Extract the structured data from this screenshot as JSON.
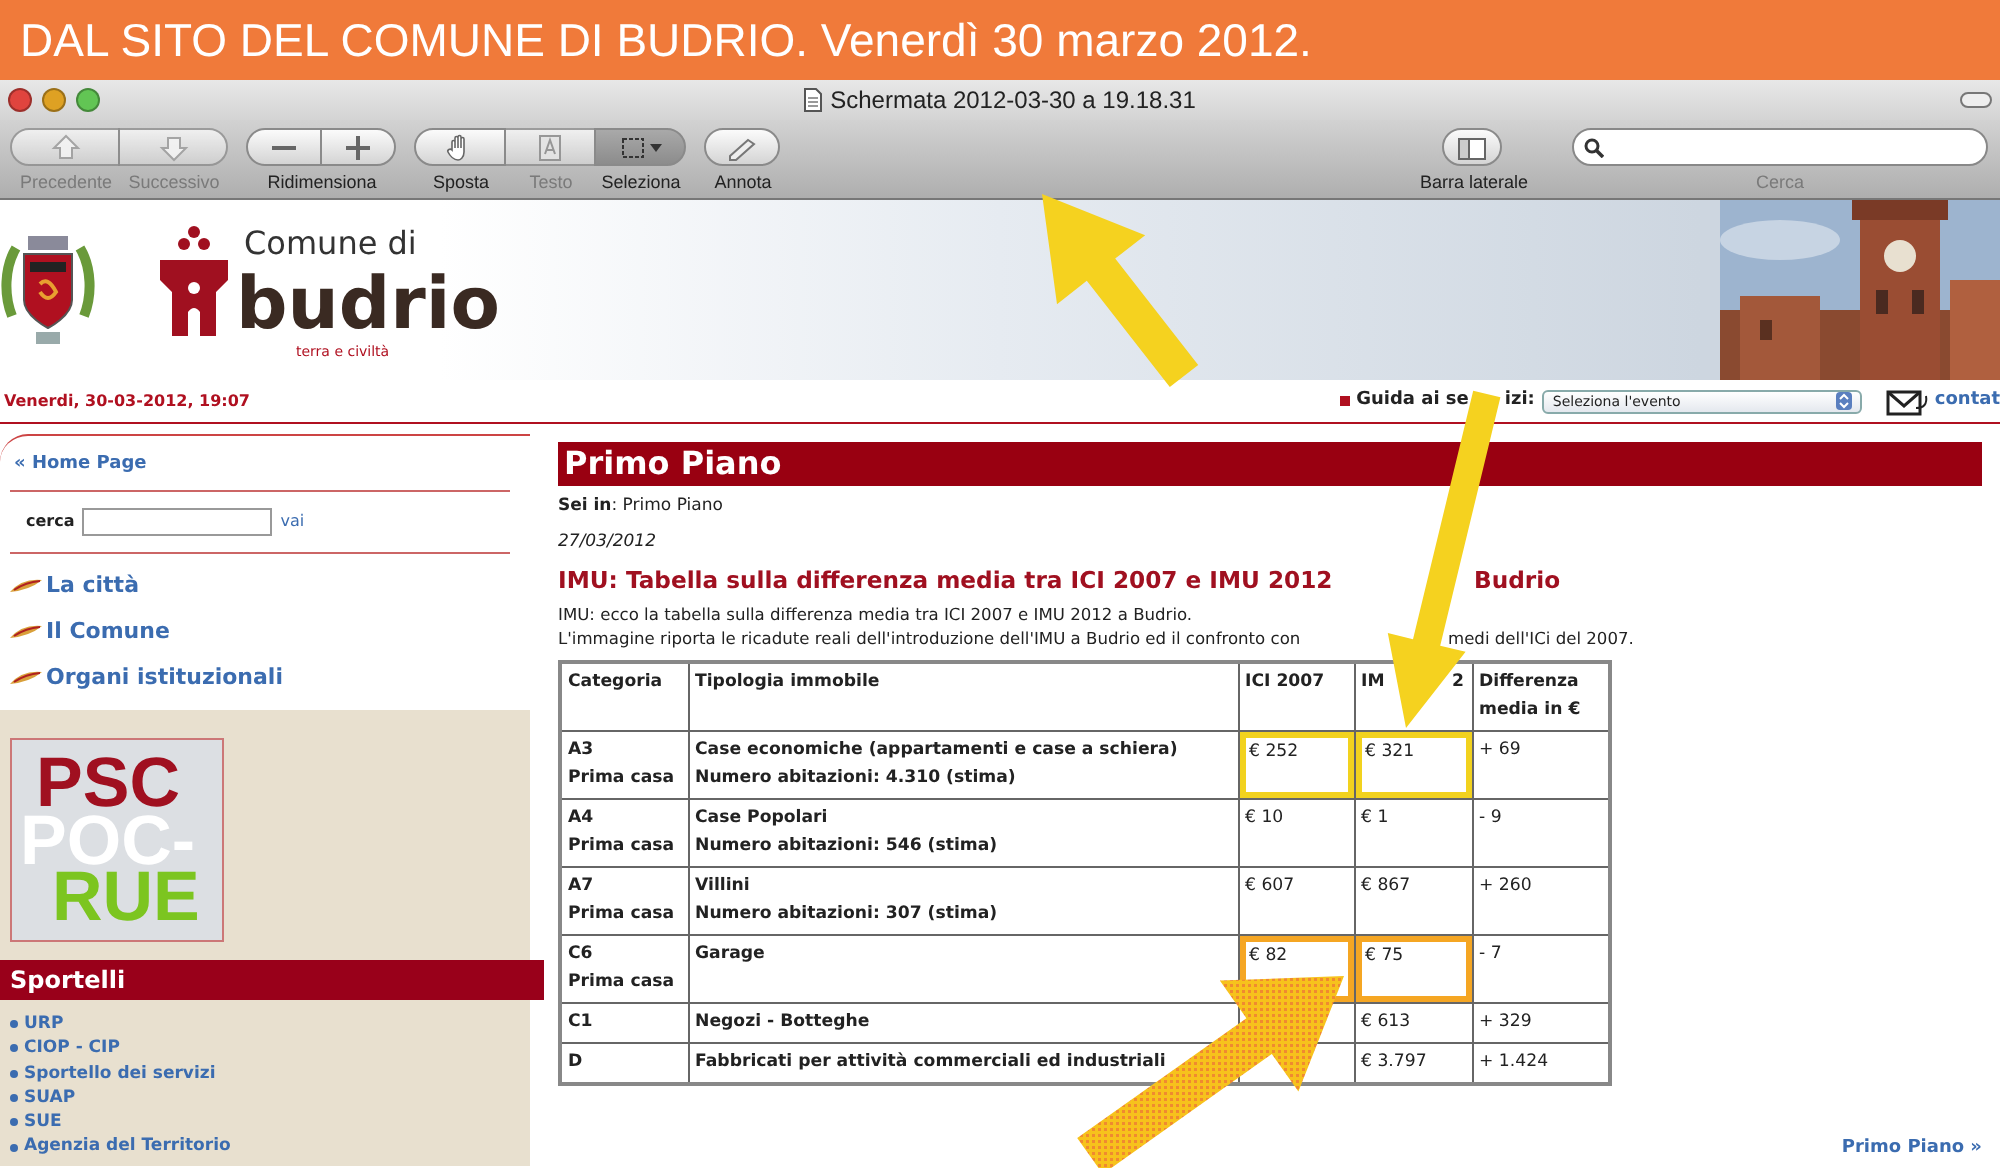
{
  "banner": {
    "text": "DAL SITO DEL COMUNE DI BUDRIO. Venerdì 30 marzo 2012."
  },
  "window": {
    "title": "Schermata 2012-03-30 a 19.18.31"
  },
  "toolbar": {
    "groups": [
      {
        "buttons": [
          {
            "kind": "up",
            "label": "Precedente",
            "disabled": true
          },
          {
            "kind": "down",
            "label": "Successivo",
            "disabled": true
          }
        ]
      },
      {
        "label": "Ridimensiona",
        "buttons": [
          {
            "kind": "minus",
            "disabled": false
          },
          {
            "kind": "plus",
            "disabled": false
          }
        ]
      },
      {
        "buttons": [
          {
            "kind": "hand",
            "label": "Sposta",
            "disabled": false,
            "selected": false
          },
          {
            "kind": "text",
            "label": "Testo",
            "disabled": true,
            "selected": false
          },
          {
            "kind": "select",
            "label": "Seleziona",
            "disabled": false,
            "selected": true
          }
        ]
      },
      {
        "buttons": [
          {
            "kind": "pencil",
            "label": "Annota",
            "disabled": false
          }
        ]
      }
    ],
    "sidebar_button": {
      "label": "Barra laterale"
    },
    "search": {
      "label": "Cerca"
    }
  },
  "site_header": {
    "comune": "Comune di",
    "name": "budrio",
    "motto": "terra e civiltà"
  },
  "site_bar": {
    "date": "Venerdi, 30-03-2012, 19:07",
    "guide_label_parts": [
      "Guida ai se",
      "izi:"
    ],
    "guide_select": "Seleziona l'evento",
    "contact": "contat"
  },
  "sidebar": {
    "home": "« Home Page",
    "search_label": "cerca",
    "search_button": "vai",
    "menu": [
      "La città",
      "Il Comune",
      "Organi istituzionali"
    ],
    "banner_lines": [
      "PSC",
      "POC-",
      "RUE"
    ],
    "desk_title": "Sportelli",
    "desks": [
      "URP",
      "CIOP - CIP",
      "Sportello dei servizi",
      "SUAP",
      "SUE",
      "Agenzia del Territorio"
    ]
  },
  "main": {
    "section_title": "Primo Piano",
    "breadcrumb": "**Sei in**: Primo Piano",
    "date": "27/03/2012",
    "title_parts": [
      "IMU: Tabella sulla differenza media tra ICI 2007 e IMU 2012",
      "Budrio"
    ],
    "intro": "IMU: ecco la tabella sulla differenza media tra ICI 2007 e IMU 2012 a Budrio.",
    "intro2_parts": [
      "L'immagine riporta le ricadute reali dell'introduzione dell'IMU a Budrio ed il confronto con",
      "medi dell'ICi del 2007."
    ],
    "table": {
      "columns": [
        {
          "parts": [
            "Categoria"
          ]
        },
        {
          "parts": [
            "Tipologia immobile"
          ]
        },
        {
          "parts": [
            "ICI 2007"
          ]
        },
        {
          "parts": [
            "IM",
            "2"
          ]
        },
        {
          "parts": [
            "Differenza media in €"
          ]
        }
      ],
      "rows": [
        {
          "category": [
            "A3",
            "Prima casa"
          ],
          "type": [
            "Case economiche (appartamenti e case a schiera)",
            "Numero abitazioni: 4.310 (stima)"
          ],
          "ici": "€ 252",
          "imu": "€ 321",
          "difference": "+ 69",
          "color": "#f2d21e"
        },
        {
          "category": [
            "A4",
            "Prima casa"
          ],
          "type": [
            "Case Popolari",
            "Numero abitazioni: 546 (stima)"
          ],
          "ici": "€ 10",
          "imu": "€ 1",
          "difference": "- 9"
        },
        {
          "category": [
            "A7",
            "Prima casa"
          ],
          "type": [
            "Villini",
            "Numero abitazioni: 307 (stima)"
          ],
          "ici": "€ 607",
          "imu": "€ 867",
          "difference": "+ 260"
        },
        {
          "category": [
            "C6",
            "Prima casa"
          ],
          "type": [
            "Garage"
          ],
          "ici": "€ 82",
          "imu": "€ 75",
          "difference": "- 7",
          "color": "#f5a623"
        },
        {
          "category": [
            "C1"
          ],
          "type": [
            "Negozi - Botteghe"
          ],
          "imu": "€ 613",
          "difference": "+ 329"
        },
        {
          "category": [
            "D"
          ],
          "type": [
            "Fabbricati per attività commerciali ed industriali"
          ],
          "imu": "€ 3.797",
          "difference": "+ 1.424"
        }
      ]
    },
    "more_link": "Primo Piano »"
  }
}
